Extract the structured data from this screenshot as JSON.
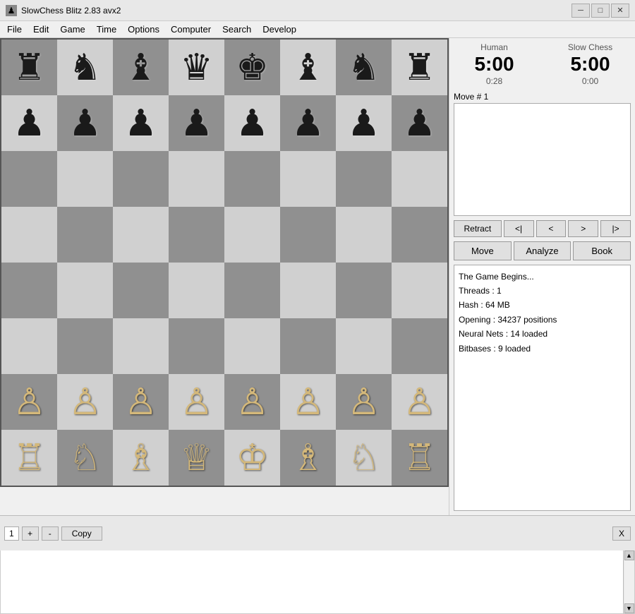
{
  "window": {
    "title": "SlowChess Blitz 2.83 avx2",
    "icon": "♟"
  },
  "menu": {
    "items": [
      "File",
      "Edit",
      "Game",
      "Time",
      "Options",
      "Computer",
      "Search",
      "Develop"
    ]
  },
  "clocks": {
    "human": {
      "label": "Human",
      "time": "5:00",
      "elapsed": "0:28"
    },
    "computer": {
      "label": "Slow Chess",
      "time": "5:00",
      "elapsed": "0:00"
    }
  },
  "move_label": "Move # 1",
  "nav_buttons": {
    "retract": "Retract",
    "first": "<|",
    "prev": "<",
    "next": ">",
    "last": "|>"
  },
  "action_buttons": {
    "move": "Move",
    "analyze": "Analyze",
    "book": "Book"
  },
  "info": {
    "line1": "The Game Begins...",
    "line2": "",
    "line3": "Threads : 1",
    "line4": "Hash : 64 MB",
    "line5": "Opening : 34237 positions",
    "line6": "Neural Nets : 14 loaded",
    "line7": "Bitbases : 9 loaded"
  },
  "tab_bar": {
    "tab_num": "1",
    "plus_label": "+",
    "minus_label": "-",
    "copy_label": "Copy",
    "x_label": "X"
  },
  "board": {
    "light_color": "#d0d0d0",
    "dark_color": "#909090",
    "pieces": {
      "black_rook": "♜",
      "black_knight": "♞",
      "black_bishop": "♝",
      "black_queen": "♛",
      "black_king": "♚",
      "black_pawn": "♟",
      "white_rook": "♖",
      "white_knight": "♘",
      "white_bishop": "♗",
      "white_queen": "♕",
      "white_king": "♔",
      "white_pawn": "♙"
    }
  }
}
